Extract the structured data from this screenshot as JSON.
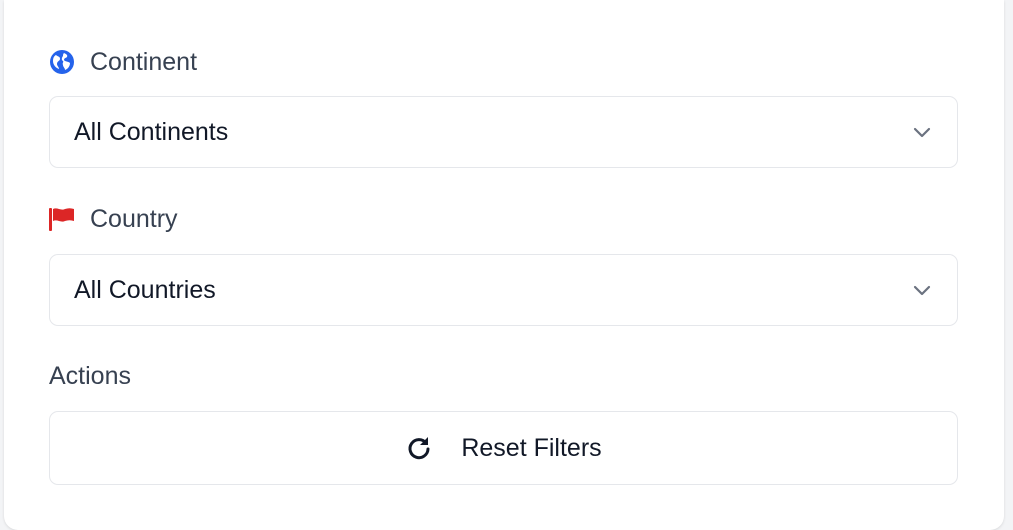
{
  "filters": {
    "continent": {
      "label": "Continent",
      "icon": "globe-icon",
      "icon_color": "#2563eb",
      "selected": "All Continents"
    },
    "country": {
      "label": "Country",
      "icon": "flag-icon",
      "icon_color": "#dc2626",
      "selected": "All Countries"
    }
  },
  "actions": {
    "label": "Actions",
    "reset_label": "Reset Filters",
    "reset_icon": "refresh-icon"
  }
}
